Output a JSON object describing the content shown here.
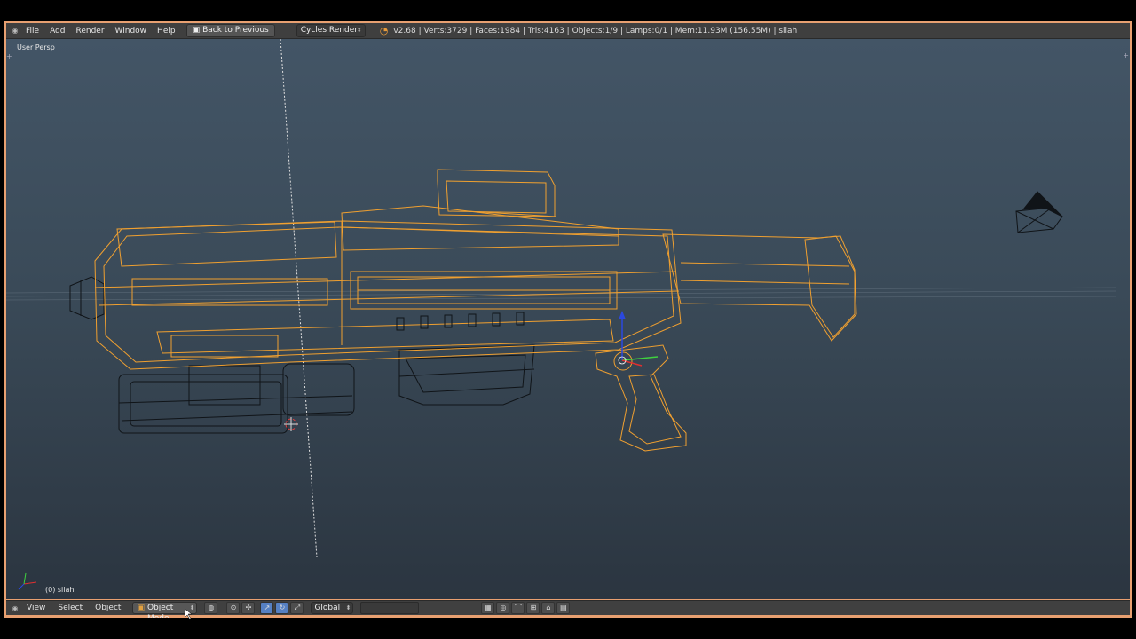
{
  "menu": {
    "items": [
      "File",
      "Add",
      "Render",
      "Window",
      "Help"
    ],
    "back_button": "Back to Previous",
    "render_engine": "Cycles Render",
    "stats": "v2.68 | Verts:3729 | Faces:1984 | Tris:4163 | Objects:1/9 | Lamps:0/1 | Mem:11.93M (156.55M) | silah"
  },
  "viewport": {
    "view_label": "User Persp",
    "object_label": "(0) silah"
  },
  "footer": {
    "view": "View",
    "select": "Select",
    "object": "Object",
    "mode": "Object Mode",
    "orientation": "Global"
  },
  "colors": {
    "selected_wire": "#f0a030",
    "unselected_wire": "#101418",
    "frame_border": "#e8a071",
    "viewport_top": "#435566",
    "viewport_bottom": "#2b3540"
  }
}
